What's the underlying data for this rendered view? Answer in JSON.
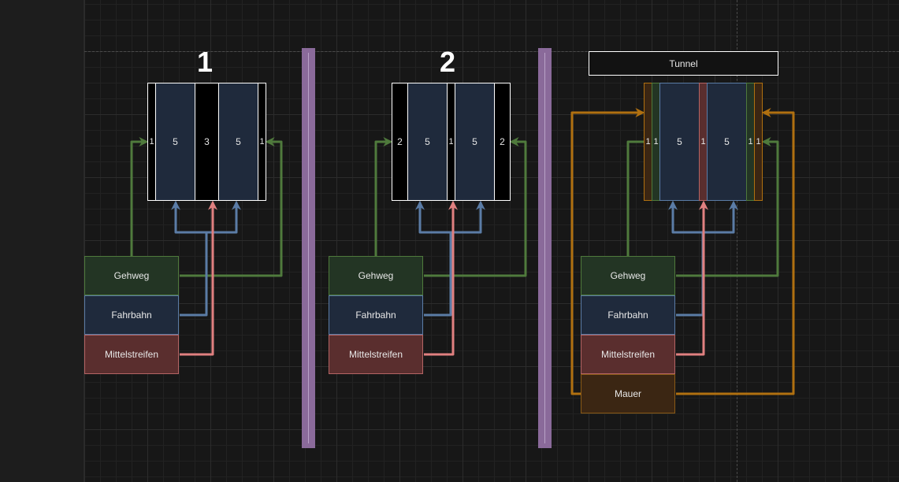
{
  "panels": [
    {
      "number": "1",
      "lanes": [
        "1",
        "5",
        "3",
        "5",
        "1"
      ],
      "legend": {
        "sidewalk": "Gehweg",
        "roadway": "Fahrbahn",
        "median": "Mittelstreifen"
      }
    },
    {
      "number": "2",
      "lanes": [
        "2",
        "5",
        "1",
        "5",
        "2"
      ],
      "legend": {
        "sidewalk": "Gehweg",
        "roadway": "Fahrbahn",
        "median": "Mittelstreifen"
      }
    },
    {
      "title": "Tunnel",
      "lanes": [
        "1",
        "1",
        "5",
        "1",
        "5",
        "1",
        "1"
      ],
      "legend": {
        "sidewalk": "Gehweg",
        "roadway": "Fahrbahn",
        "median": "Mittelstreifen",
        "wall": "Mauer"
      }
    }
  ],
  "colors": {
    "sidewalk": "#4f7a3c",
    "roadway": "#5b7ca6",
    "median": "#e08080",
    "wall": "#b07010",
    "separator": "#8a6a9a"
  }
}
